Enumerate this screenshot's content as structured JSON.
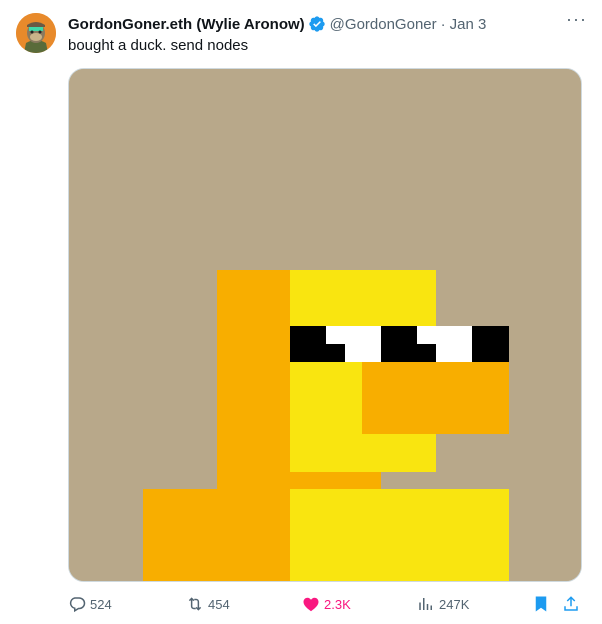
{
  "tweet": {
    "display_name": "GordonGoner.eth (Wylie Aronow)",
    "handle": "@GordonGoner",
    "separator": "·",
    "date": "Jan 3",
    "text": "bought a duck. send nodes",
    "more_label": "···",
    "media_description": "pixel art duck with sunglasses"
  },
  "actions": {
    "replies": "524",
    "retweets": "454",
    "likes": "2.3K",
    "views": "247K"
  },
  "colors": {
    "verified": "#1d9bf0",
    "like": "#f91880",
    "bookmark": "#1d9bf0",
    "share": "#1d9bf0",
    "media_background": "#b8a88a",
    "duck_yellow": "#f9e510",
    "duck_orange": "#f8ae00"
  },
  "icons": {
    "verified": "verified-badge-icon",
    "reply": "reply-icon",
    "retweet": "retweet-icon",
    "like": "heart-icon",
    "views": "views-icon",
    "bookmark": "bookmark-icon",
    "share": "share-icon",
    "more": "more-icon"
  }
}
